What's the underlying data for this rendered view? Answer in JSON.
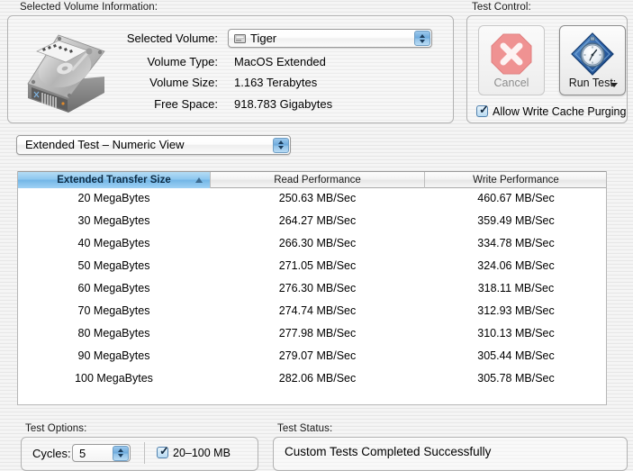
{
  "groups": {
    "volume_info_label": "Selected Volume Information:",
    "test_control_label": "Test Control:",
    "test_options_label": "Test Options:",
    "test_status_label": "Test Status:"
  },
  "volume_info": {
    "icon": "hard-disk-icon",
    "rows": [
      {
        "label": "Selected Volume:",
        "value": "Tiger"
      },
      {
        "label": "Volume Type:",
        "value": "MacOS Extended"
      },
      {
        "label": "Volume Size:",
        "value": "1.163 Terabytes"
      },
      {
        "label": "Free Space:",
        "value": "918.783 Gigabytes"
      }
    ],
    "popup": {
      "selected": "Tiger",
      "icon": "disk-drive-icon"
    }
  },
  "test_control": {
    "cancel": {
      "label": "Cancel",
      "icon": "stop-octagon-x-icon",
      "enabled": false,
      "color": "#ea8a8a"
    },
    "run_test": {
      "label": "Run Test:",
      "icon": "stopwatch-diamond-icon",
      "enabled": true,
      "color": "#2a5fa8"
    },
    "write_cache": {
      "label": "Allow Write Cache Purging",
      "checked": true
    }
  },
  "view_popup": {
    "selected": "Extended Test – Numeric View"
  },
  "table": {
    "columns": [
      {
        "header": "Extended Transfer Size",
        "sorted": true,
        "sort_direction": "ascending"
      },
      {
        "header": "Read Performance",
        "sorted": false
      },
      {
        "header": "Write Performance",
        "sorted": false
      }
    ],
    "rows": [
      {
        "size": "20 MegaBytes",
        "read": "250.63 MB/Sec",
        "write": "460.67 MB/Sec"
      },
      {
        "size": "30 MegaBytes",
        "read": "264.27 MB/Sec",
        "write": "359.49 MB/Sec"
      },
      {
        "size": "40 MegaBytes",
        "read": "266.30 MB/Sec",
        "write": "334.78 MB/Sec"
      },
      {
        "size": "50 MegaBytes",
        "read": "271.05 MB/Sec",
        "write": "324.06 MB/Sec"
      },
      {
        "size": "60 MegaBytes",
        "read": "276.30 MB/Sec",
        "write": "318.11 MB/Sec"
      },
      {
        "size": "70 MegaBytes",
        "read": "274.74 MB/Sec",
        "write": "312.93 MB/Sec"
      },
      {
        "size": "80 MegaBytes",
        "read": "277.98 MB/Sec",
        "write": "310.13 MB/Sec"
      },
      {
        "size": "90 MegaBytes",
        "read": "279.07 MB/Sec",
        "write": "305.44 MB/Sec"
      },
      {
        "size": "100 MegaBytes",
        "read": "282.06 MB/Sec",
        "write": "305.78 MB/Sec"
      }
    ]
  },
  "test_options": {
    "cycles_label": "Cycles:",
    "cycles_value": "5",
    "range_label": "20–100 MB",
    "range_checked": true
  },
  "test_status": {
    "message": "Custom Tests Completed Successfully"
  },
  "chart_data": {
    "type": "table",
    "title": "Extended Test – Numeric View",
    "categories": [
      "20 MegaBytes",
      "30 MegaBytes",
      "40 MegaBytes",
      "50 MegaBytes",
      "60 MegaBytes",
      "70 MegaBytes",
      "80 MegaBytes",
      "90 MegaBytes",
      "100 MegaBytes"
    ],
    "xlabel": "Extended Transfer Size",
    "ylabel": "MB/Sec",
    "series": [
      {
        "name": "Read Performance",
        "values": [
          250.63,
          264.27,
          266.3,
          271.05,
          276.3,
          274.74,
          277.98,
          279.07,
          282.06
        ]
      },
      {
        "name": "Write Performance",
        "values": [
          460.67,
          359.49,
          334.78,
          324.06,
          318.11,
          312.93,
          310.13,
          305.44,
          305.78
        ]
      }
    ]
  }
}
